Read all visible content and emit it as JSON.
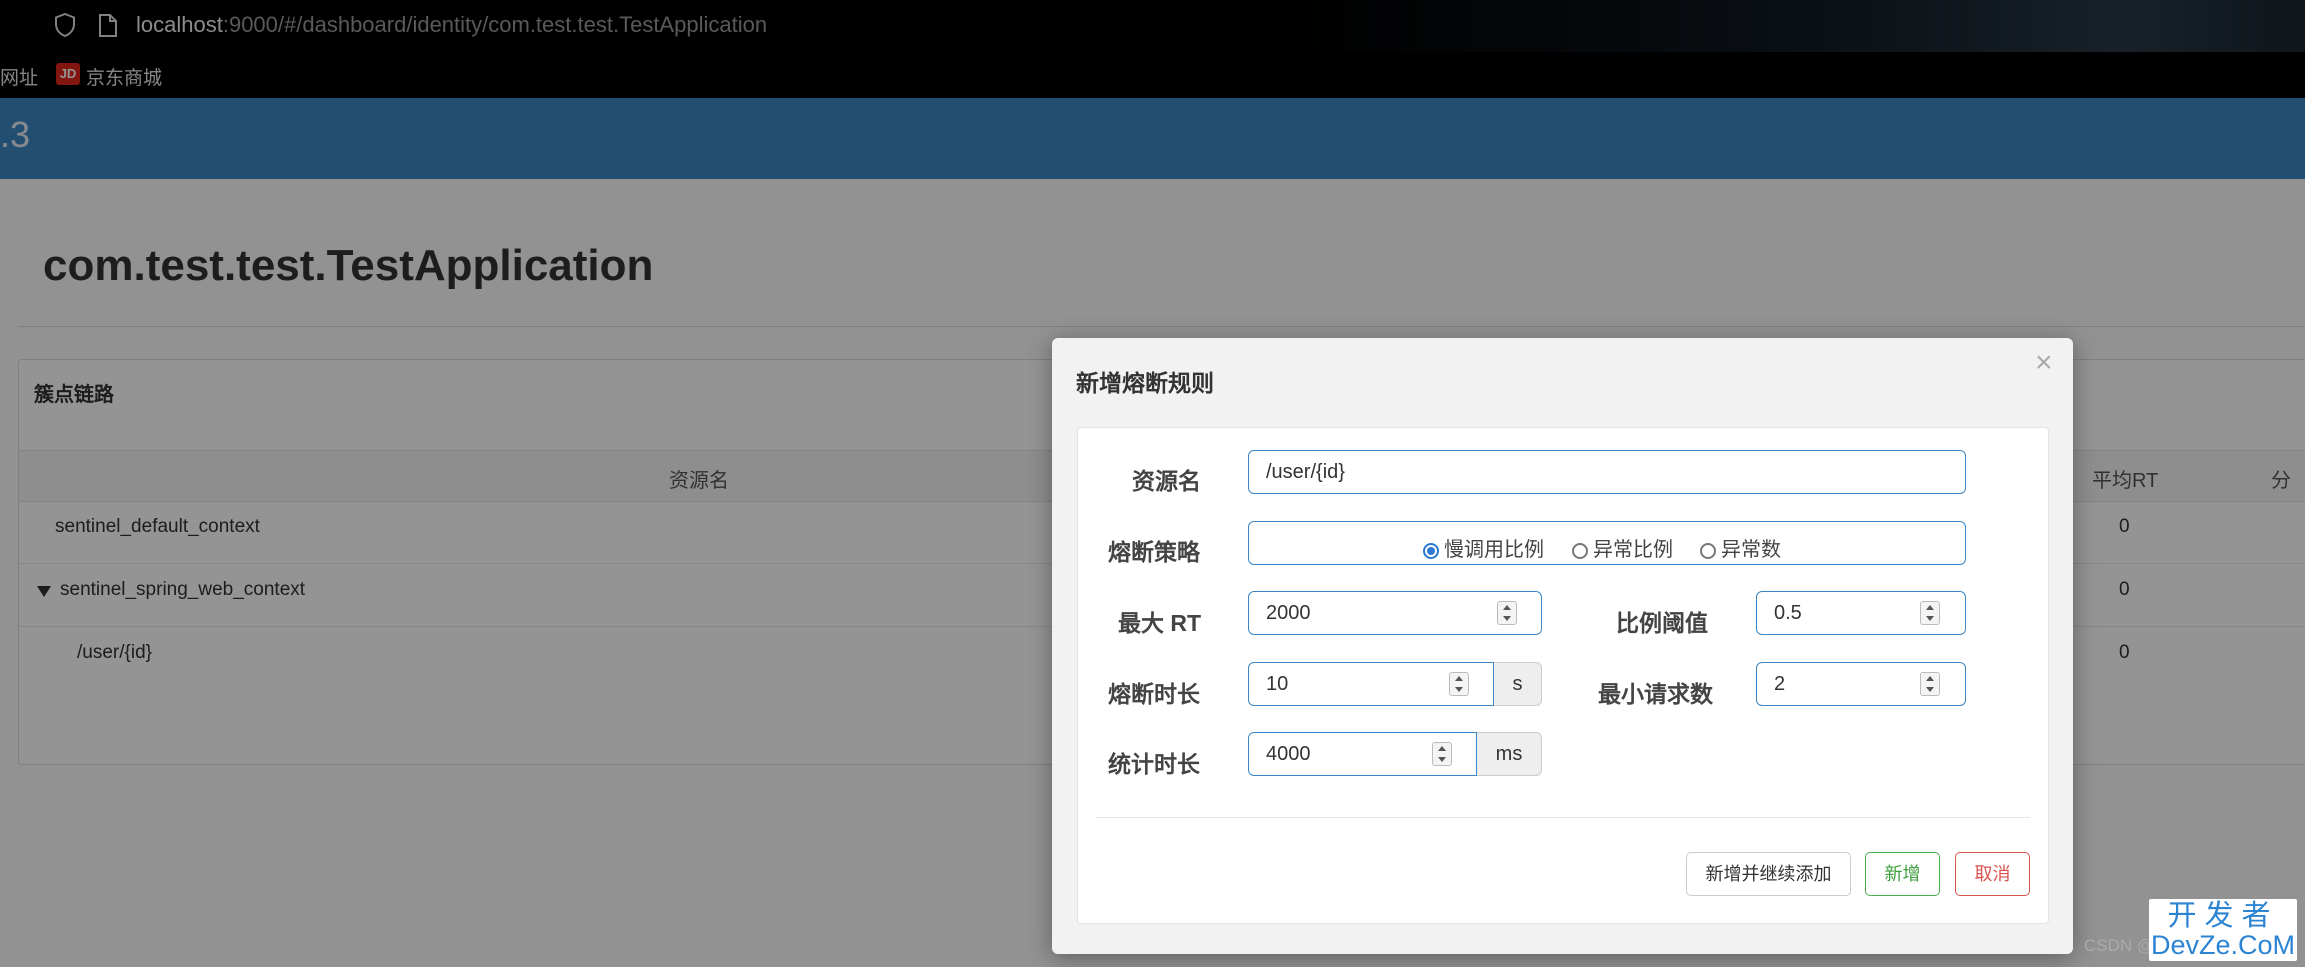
{
  "browser": {
    "url_host": "localhost",
    "url_rest": ":9000/#/dashboard/identity/com.test.test.TestApplication",
    "bookmarks": [
      {
        "label": "网址"
      },
      {
        "label": "京东商城",
        "icon": "JD"
      }
    ]
  },
  "app": {
    "header_version": ".3",
    "title": "com.test.test.TestApplication",
    "panel": {
      "title": "簇点链路",
      "columns": [
        "资源名",
        "平均RT",
        "分"
      ],
      "rows": [
        {
          "name": "sentinel_default_context",
          "avg_rt": "0"
        },
        {
          "name": "sentinel_spring_web_context",
          "avg_rt": "0",
          "expanded": true
        },
        {
          "name": "/user/{id}",
          "avg_rt": "0"
        }
      ]
    }
  },
  "modal": {
    "title": "新增熔断规则",
    "close": "×",
    "fields": {
      "resource_label": "资源名",
      "resource_value": "/user/{id}",
      "strategy_label": "熔断策略",
      "strategy_options": [
        "慢调用比例",
        "异常比例",
        "异常数"
      ],
      "strategy_selected": "慢调用比例",
      "max_rt_label": "最大 RT",
      "max_rt_value": "2000",
      "ratio_label": "比例阈值",
      "ratio_value": "0.5",
      "duration_label": "熔断时长",
      "duration_value": "10",
      "duration_unit": "s",
      "min_req_label": "最小请求数",
      "min_req_value": "2",
      "stat_label": "统计时长",
      "stat_value": "4000",
      "stat_unit": "ms"
    },
    "buttons": {
      "add_continue": "新增并继续添加",
      "add": "新增",
      "cancel": "取消"
    }
  },
  "watermark": {
    "csdn": "CSDN @",
    "line1": "开发者",
    "line2": "DevZe.CoM"
  },
  "colors": {
    "header_blue": "#3c87c4",
    "primary": "#2b79d0",
    "success": "#4cae4c",
    "danger": "#d9534f"
  }
}
